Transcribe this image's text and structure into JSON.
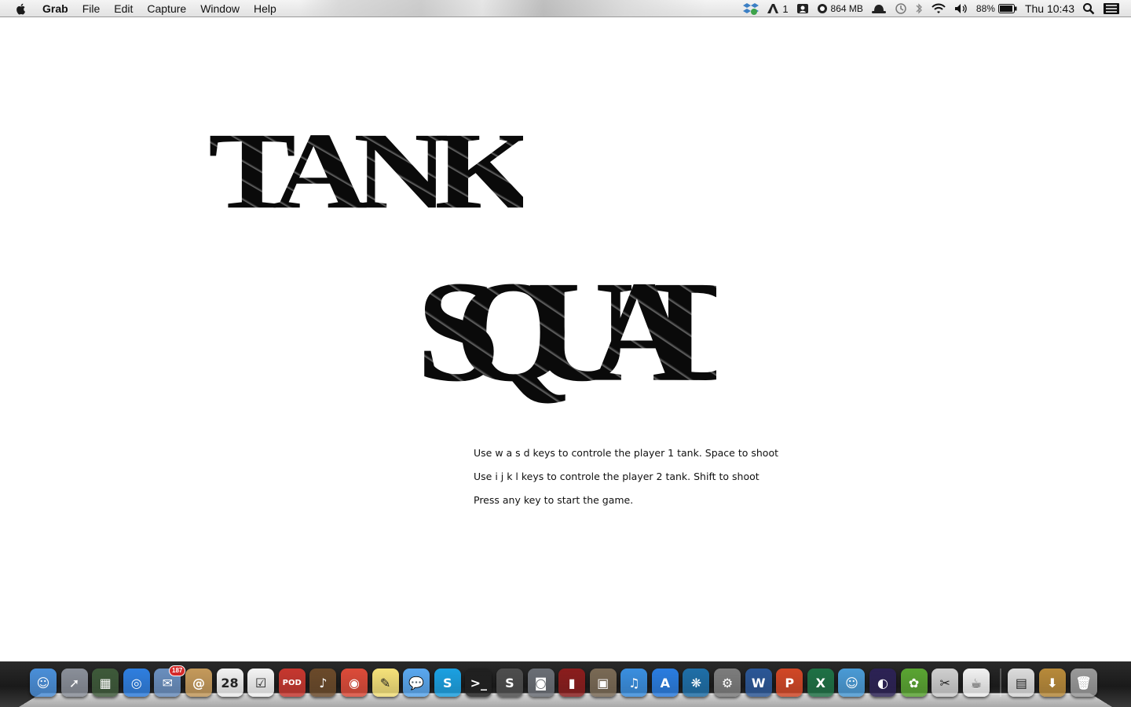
{
  "menubar": {
    "app_name": "Grab",
    "menus": [
      "File",
      "Edit",
      "Capture",
      "Window",
      "Help"
    ],
    "status": {
      "adobe_count": "1",
      "memory": "864 MB",
      "battery": "88%",
      "clock": "Thu 10:43"
    }
  },
  "game": {
    "title_line1": "TANK",
    "title_line2": "SQUAD",
    "instructions": [
      "Use w a s d keys to controle the player 1 tank. Space to shoot",
      "Use i j k l keys to controle the player 2 tank. Shift to shoot",
      "Press any key to start the game."
    ]
  },
  "dock": {
    "items": [
      {
        "name": "finder-icon",
        "color": "#4a8fd9",
        "glyph": "☺"
      },
      {
        "name": "launchpad-icon",
        "color": "#8a8f99",
        "glyph": "➚"
      },
      {
        "name": "mission-control-icon",
        "color": "#3e5a3a",
        "glyph": "▦"
      },
      {
        "name": "safari-icon",
        "color": "#2f7fe0",
        "glyph": "◎"
      },
      {
        "name": "mail-icon",
        "color": "#6a8fbf",
        "glyph": "✉",
        "badge": "187"
      },
      {
        "name": "contacts-icon",
        "color": "#c59a5b",
        "glyph": "@"
      },
      {
        "name": "calendar-icon",
        "color": "#f2f2f2",
        "glyph": "28",
        "dark": true
      },
      {
        "name": "reminders-icon",
        "color": "#f4f4f4",
        "glyph": "☑",
        "dark": true
      },
      {
        "name": "podcast-app-icon",
        "color": "#c7372f",
        "glyph": "POD"
      },
      {
        "name": "garageband-icon",
        "color": "#6b4a2a",
        "glyph": "♪"
      },
      {
        "name": "chrome-icon",
        "color": "#dd4b39",
        "glyph": "◉"
      },
      {
        "name": "stickies-icon",
        "color": "#f6e27a",
        "glyph": "✎",
        "dark": true
      },
      {
        "name": "messages-icon",
        "color": "#5aa8f0",
        "glyph": "💬"
      },
      {
        "name": "skype-icon",
        "color": "#1ba1e2",
        "glyph": "S"
      },
      {
        "name": "terminal-icon",
        "color": "#202020",
        "glyph": ">_"
      },
      {
        "name": "sublime-icon",
        "color": "#4d4d4d",
        "glyph": "S"
      },
      {
        "name": "facetime-icon",
        "color": "#6a6e75",
        "glyph": "◙"
      },
      {
        "name": "photo-booth-icon",
        "color": "#8b1d1d",
        "glyph": "▮"
      },
      {
        "name": "iphoto-icon",
        "color": "#7a6a55",
        "glyph": "▣"
      },
      {
        "name": "itunes-icon",
        "color": "#3a8fe0",
        "glyph": "♫"
      },
      {
        "name": "app-store-icon",
        "color": "#2a7de1",
        "glyph": "A"
      },
      {
        "name": "sourcetree-icon",
        "color": "#1e6fa8",
        "glyph": "❋"
      },
      {
        "name": "system-preferences-icon",
        "color": "#7d7d7d",
        "glyph": "⚙"
      },
      {
        "name": "word-icon",
        "color": "#2b5797",
        "glyph": "W"
      },
      {
        "name": "powerpoint-icon",
        "color": "#d24726",
        "glyph": "P"
      },
      {
        "name": "excel-icon",
        "color": "#1e7145",
        "glyph": "X"
      },
      {
        "name": "messenger-icon",
        "color": "#4a9bd6",
        "glyph": "☺"
      },
      {
        "name": "eclipse-icon",
        "color": "#2c2255",
        "glyph": "◐"
      },
      {
        "name": "evernote-icon",
        "color": "#5aa532",
        "glyph": "✿"
      },
      {
        "name": "utilities-icon",
        "color": "#cfcfcf",
        "glyph": "✂",
        "dark": true
      },
      {
        "name": "java-icon",
        "color": "#f2f2f2",
        "glyph": "☕",
        "dark": true
      },
      {
        "name": "separator"
      },
      {
        "name": "documents-folder-icon",
        "color": "#dcdcdc",
        "glyph": "▤",
        "dark": true
      },
      {
        "name": "downloads-stack-icon",
        "color": "#b88a3a",
        "glyph": "⬇"
      },
      {
        "name": "trash-icon",
        "color": "#9a9a9a",
        "glyph": "🗑"
      }
    ]
  }
}
